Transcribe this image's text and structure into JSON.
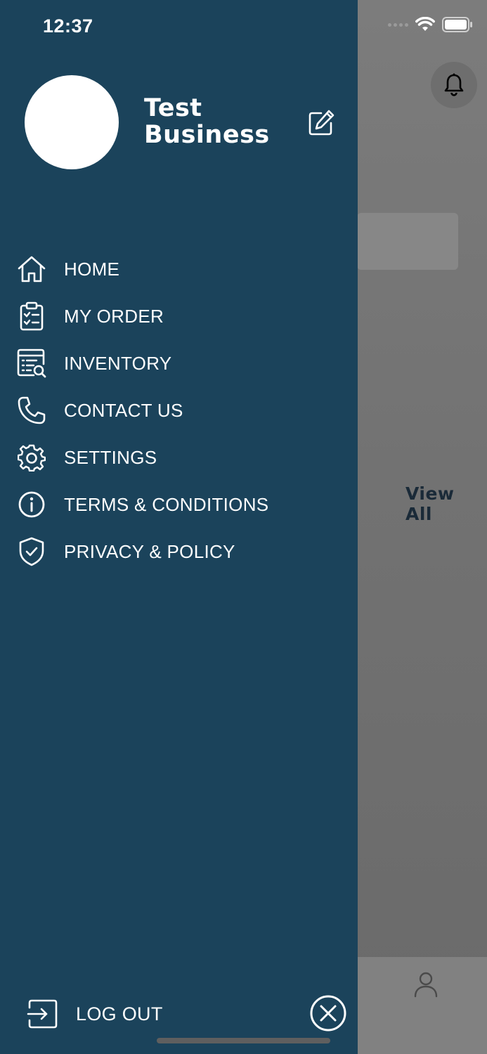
{
  "status_bar": {
    "time": "12:37"
  },
  "profile": {
    "business_name": "Test Business"
  },
  "menu": {
    "items": [
      {
        "label": "HOME",
        "icon": "home-icon"
      },
      {
        "label": "MY ORDER",
        "icon": "clipboard-check-icon"
      },
      {
        "label": "INVENTORY",
        "icon": "inventory-search-icon"
      },
      {
        "label": "CONTACT US",
        "icon": "phone-icon"
      },
      {
        "label": "SETTINGS",
        "icon": "gear-icon"
      },
      {
        "label": "TERMS & CONDITIONS",
        "icon": "info-icon"
      },
      {
        "label": "PRIVACY & POLICY",
        "icon": "shield-check-icon"
      }
    ]
  },
  "footer": {
    "logout_label": "LOG OUT"
  },
  "background": {
    "view_all": "View All"
  },
  "colors": {
    "drawer_bg": "#1b435b",
    "text": "#ffffff",
    "overlay": "#6b6b6b"
  }
}
